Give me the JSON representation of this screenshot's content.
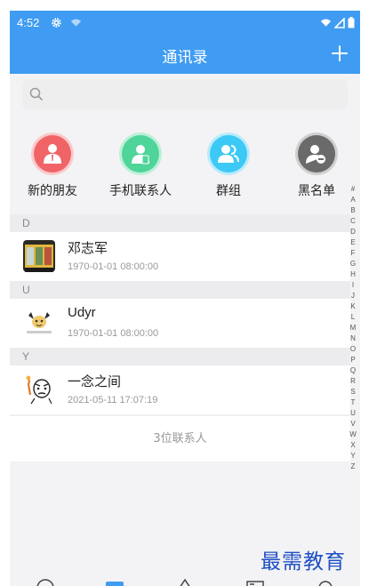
{
  "status": {
    "time": "4:52"
  },
  "header": {
    "title": "通讯录",
    "add_icon": "plus-icon"
  },
  "search": {
    "placeholder": ""
  },
  "quick_actions": [
    {
      "label": "新的朋友",
      "icon": "new-friend-icon",
      "color": "#f06468"
    },
    {
      "label": "手机联系人",
      "icon": "phone-contacts-icon",
      "color": "#4fd49a"
    },
    {
      "label": "群组",
      "icon": "group-icon",
      "color": "#3cc9f5"
    },
    {
      "label": "黑名单",
      "icon": "blacklist-icon",
      "color": "#6a6a6a"
    }
  ],
  "sections": [
    {
      "letter": "D",
      "contacts": [
        {
          "name": "邓志军",
          "time": "1970-01-01 08:00:00"
        }
      ]
    },
    {
      "letter": "U",
      "contacts": [
        {
          "name": "Udyr",
          "time": "1970-01-01 08:00:00"
        }
      ]
    },
    {
      "letter": "Y",
      "contacts": [
        {
          "name": "一念之间",
          "time": "2021-05-11 17:07:19"
        }
      ]
    }
  ],
  "contact_count": "3位联系人",
  "index_letters": [
    "#",
    "A",
    "B",
    "C",
    "D",
    "E",
    "F",
    "G",
    "H",
    "I",
    "J",
    "K",
    "L",
    "M",
    "N",
    "O",
    "P",
    "Q",
    "R",
    "S",
    "T",
    "U",
    "V",
    "W",
    "X",
    "Y",
    "Z"
  ],
  "watermark": "最需教育",
  "colors": {
    "primary": "#3f9cf2",
    "background": "#f3f3f5"
  }
}
